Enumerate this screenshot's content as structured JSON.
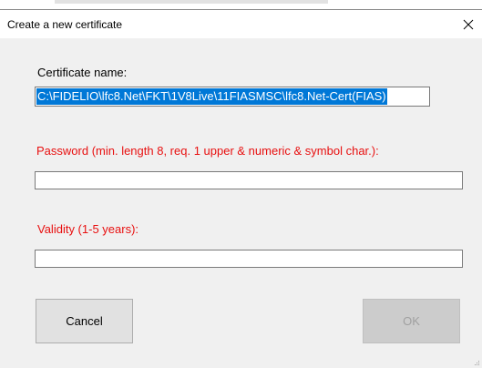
{
  "window": {
    "title": "Create a new certificate",
    "close_icon": "close-icon"
  },
  "form": {
    "certificate_name": {
      "label": "Certificate name:",
      "value": "C:\\FIDELIO\\lfc8.Net\\FKT\\1V8Live\\11FIASMSC\\lfc8.Net-Cert(FIAS)"
    },
    "password": {
      "label": "Password (min. length 8, req. 1 upper & numeric & symbol char.):",
      "value": ""
    },
    "validity": {
      "label": "Validity (1-5 years):",
      "value": ""
    }
  },
  "buttons": {
    "cancel_label": "Cancel",
    "ok_label": "OK"
  },
  "colors": {
    "error_label": "#e81010",
    "selection": "#0078d7",
    "dialog_bg": "#f0f0f0"
  }
}
